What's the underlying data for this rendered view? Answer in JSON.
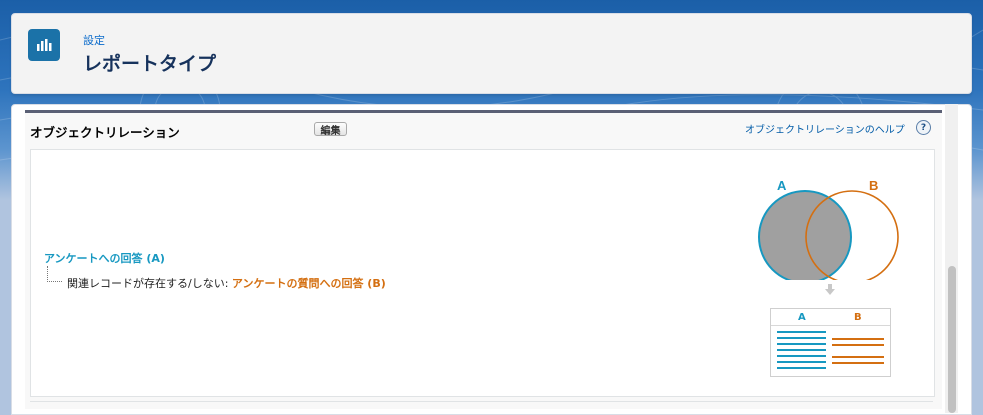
{
  "header": {
    "breadcrumb": "設定",
    "title": "レポートタイプ",
    "icon": "report-chart-icon"
  },
  "section": {
    "title": "オブジェクトリレーション",
    "edit_label": "編集",
    "help_link": "オブジェクトリレーションのヘルプ",
    "help_icon_text": "?"
  },
  "relation": {
    "primary_object": "アンケートへの回答 (A)",
    "relation_text": "関連レコードが存在する/しない: ",
    "related_object": "アンケートの質問への回答 (B)"
  },
  "diagram": {
    "label_a": "A",
    "label_b": "B",
    "table_col_a": "A",
    "table_col_b": "B",
    "rows_a": 7,
    "rows_b": 4,
    "color_a": "#1798c1",
    "color_b": "#d46f11",
    "fill_a": "#a0a0a0"
  },
  "colors": {
    "accent": "#1b72a8",
    "link": "#015ba7"
  }
}
